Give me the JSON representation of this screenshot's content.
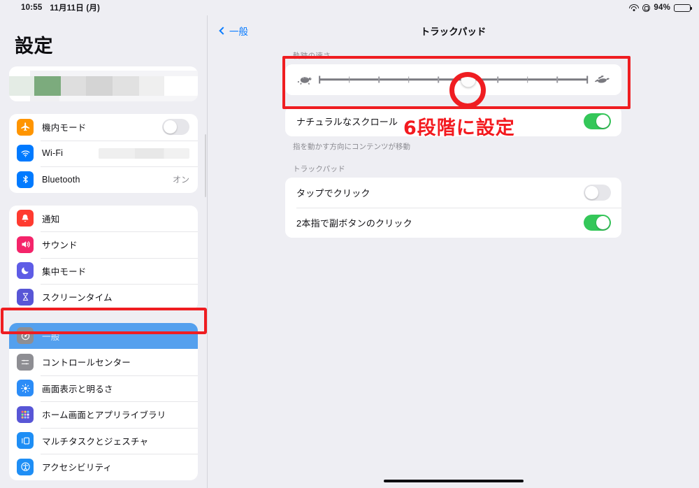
{
  "status_bar": {
    "time": "10:55",
    "date": "11月11日 (月)",
    "battery_percent": "94%",
    "wifi_icon": "wifi-icon",
    "lock_icon": "screen-lock-icon",
    "battery_icon": "battery-icon"
  },
  "sidebar": {
    "title": "設定",
    "account_card": {
      "redacted": true
    },
    "groups": [
      {
        "rows": [
          {
            "label": "機内モード",
            "icon": "airplane-icon",
            "icon_color": "#ff9500",
            "glyph": "✈",
            "control": "toggle",
            "toggle_state": "off"
          },
          {
            "label": "Wi-Fi",
            "icon": "wifi-icon",
            "icon_color": "#007aff",
            "glyph": "wifi",
            "control": "redacted-value"
          },
          {
            "label": "Bluetooth",
            "icon": "bluetooth-icon",
            "icon_color": "#007aff",
            "glyph": "bt",
            "control": "value",
            "value": "オン"
          }
        ]
      },
      {
        "rows": [
          {
            "label": "通知",
            "icon": "bell-icon",
            "icon_color": "#ff3b30",
            "glyph": "bell"
          },
          {
            "label": "サウンド",
            "icon": "speaker-icon",
            "icon_color": "#f4246a",
            "glyph": "speaker"
          },
          {
            "label": "集中モード",
            "icon": "moon-icon",
            "icon_color": "#5e5ce6",
            "glyph": "moon"
          },
          {
            "label": "スクリーンタイム",
            "icon": "hourglass-icon",
            "icon_color": "#5856d6",
            "glyph": "hourglass"
          }
        ]
      },
      {
        "rows": [
          {
            "label": "一般",
            "icon": "gear-icon",
            "icon_color": "#8e8e93",
            "glyph": "gear",
            "selected": true
          },
          {
            "label": "コントロールセンター",
            "icon": "control-center-icon",
            "icon_color": "#8e8e93",
            "glyph": "cc"
          },
          {
            "label": "画面表示と明るさ",
            "icon": "brightness-icon",
            "icon_color": "#2b8cf7",
            "glyph": "sun"
          },
          {
            "label": "ホーム画面とアプリライブラリ",
            "icon": "home-screen-icon",
            "icon_color": "#5856d6",
            "glyph": "grid"
          },
          {
            "label": "マルチタスクとジェスチャ",
            "icon": "multitasking-icon",
            "icon_color": "#1e8ef5",
            "glyph": "split"
          },
          {
            "label": "アクセシビリティ",
            "icon": "accessibility-icon",
            "icon_color": "#1e8ef5",
            "glyph": "access"
          }
        ]
      }
    ]
  },
  "detail": {
    "back_label": "一般",
    "back_icon": "chevron-left-icon",
    "title": "トラックパッド",
    "tracking_speed": {
      "header": "軌跡の速さ",
      "slow_icon": "turtle-icon",
      "fast_icon": "rabbit-icon",
      "tick_count": 10,
      "value_index": 6
    },
    "scroll_section": {
      "rows": [
        {
          "label": "ナチュラルなスクロール",
          "control": "toggle",
          "toggle_state": "on"
        }
      ],
      "footnote": "指を動かす方向にコンテンツが移動"
    },
    "trackpad_section": {
      "header": "トラックパッド",
      "rows": [
        {
          "label": "タップでクリック",
          "control": "toggle",
          "toggle_state": "off"
        },
        {
          "label": "2本指で副ボタンのクリック",
          "control": "toggle",
          "toggle_state": "on"
        }
      ]
    }
  },
  "annotations": {
    "callout_text": "6段階に設定",
    "callout_color": "#f31a1f",
    "highlight_color": "#ef1d21"
  }
}
